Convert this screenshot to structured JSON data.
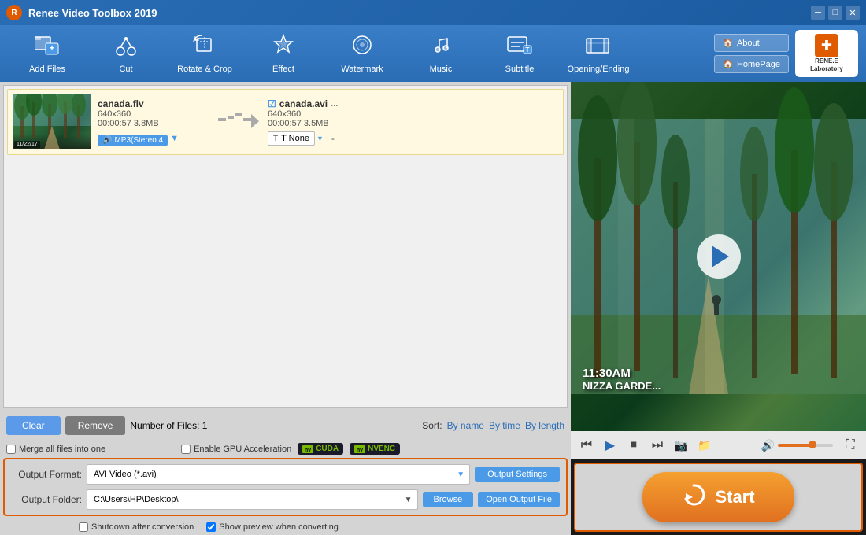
{
  "app": {
    "title": "Renee Video Toolbox 2019",
    "logo_text": "R"
  },
  "titlebar": {
    "minimize": "─",
    "maximize": "□",
    "close": "✕"
  },
  "toolbar": {
    "items": [
      {
        "id": "add-files",
        "label": "Add Files",
        "icon": "🎬"
      },
      {
        "id": "cut",
        "label": "Cut",
        "icon": "✂"
      },
      {
        "id": "rotate-crop",
        "label": "Rotate & Crop",
        "icon": "⟳"
      },
      {
        "id": "effect",
        "label": "Effect",
        "icon": "✨"
      },
      {
        "id": "watermark",
        "label": "Watermark",
        "icon": "💧"
      },
      {
        "id": "music",
        "label": "Music",
        "icon": "♪"
      },
      {
        "id": "subtitle",
        "label": "Subtitle",
        "icon": "💬"
      },
      {
        "id": "opening-ending",
        "label": "Opening/Ending",
        "icon": "🎞"
      }
    ],
    "about_label": "About",
    "homepage_label": "HomePage",
    "brand_name": "RENE.E",
    "brand_sub": "Laboratory"
  },
  "file_list": {
    "source": {
      "filename": "canada.flv",
      "dimensions": "640x360",
      "duration": "00:00:57",
      "size": "3.8MB",
      "audio": "MP3(Stereo 4"
    },
    "dest": {
      "filename": "canada.avi",
      "dimensions": "640x360",
      "duration": "00:00:57",
      "size": "3.5MB",
      "extra": "..."
    },
    "subtitle_label": "T None",
    "dash": "-"
  },
  "bottom_bar": {
    "clear_label": "Clear",
    "remove_label": "Remove",
    "file_count_label": "Number of Files:",
    "file_count": "1",
    "sort_label": "Sort:",
    "sort_by_name": "By name",
    "sort_by_time": "By time",
    "sort_by_length": "By length"
  },
  "options": {
    "merge_label": "Merge all files into one",
    "gpu_label": "Enable GPU Acceleration",
    "cuda_label": "CUDA",
    "nvenc_label": "NVENC"
  },
  "output": {
    "format_label": "Output Format:",
    "format_value": "AVI Video (*.avi)",
    "settings_btn": "Output Settings",
    "folder_label": "Output Folder:",
    "folder_value": "C:\\Users\\HP\\Desktop\\",
    "browse_btn": "Browse",
    "open_btn": "Open Output File",
    "shutdown_label": "Shutdown after conversion",
    "preview_label": "Show preview when converting"
  },
  "video": {
    "overlay_time": "11:30AM",
    "overlay_location": "NIZZA GARDE...",
    "controls": {
      "skip_back": "⏮",
      "play": "▶",
      "stop": "⏹",
      "skip_fwd": "⏭",
      "camera": "📷",
      "folder": "📁",
      "volume": "🔊",
      "fullscreen": "⛶"
    }
  },
  "start": {
    "label": "Start"
  }
}
